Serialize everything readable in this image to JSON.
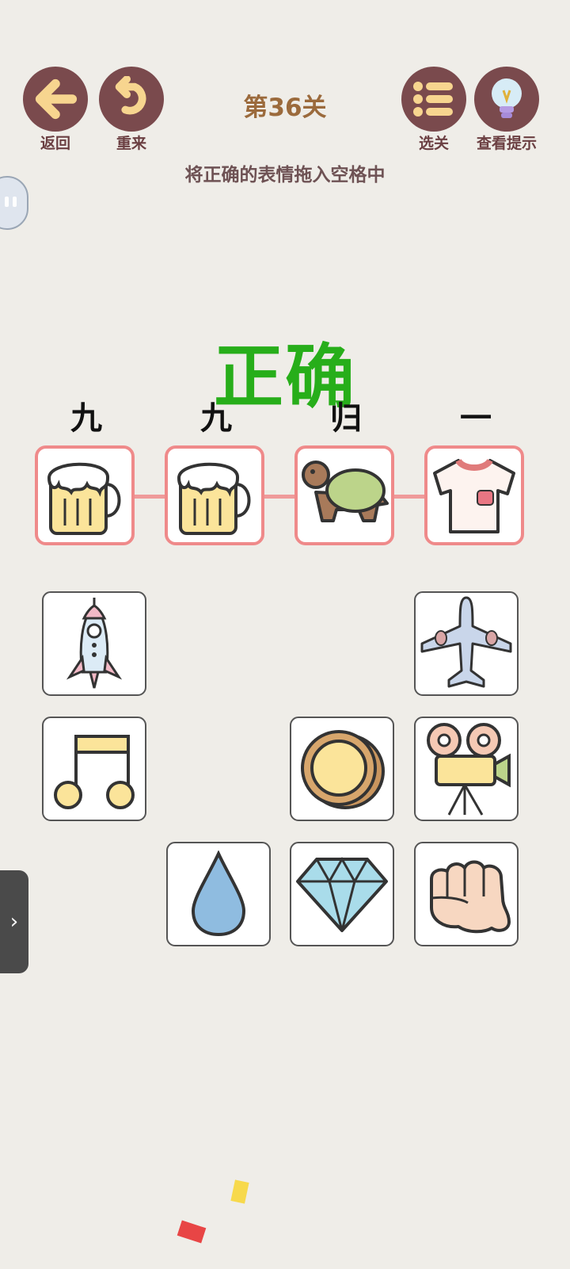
{
  "header": {
    "back_label": "返回",
    "restart_label": "重来",
    "level_title": "第36关",
    "select_level_label": "选关",
    "hint_label": "查看提示"
  },
  "instruction": "将正确的表情拖入空格中",
  "result_text": "正确",
  "phrase_chars": [
    "九",
    "九",
    "归",
    "一"
  ],
  "answer_slots": [
    "beer-mug-icon",
    "beer-mug-icon",
    "turtle-icon",
    "tshirt-icon"
  ],
  "choice_tiles": [
    "rocket-icon",
    "airplane-icon",
    "music-note-icon",
    "coin-icon",
    "movie-camera-icon",
    "water-drop-icon",
    "diamond-icon",
    "fist-icon"
  ],
  "colors": {
    "button_bg": "#7a4a4d",
    "title": "#9b6a3c",
    "result": "#27ae1a",
    "slot_border": "#ef8a8a"
  }
}
